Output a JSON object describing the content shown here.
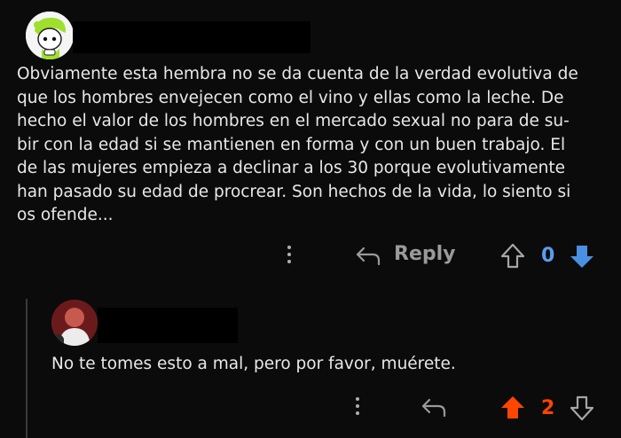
{
  "comment": {
    "text": "Obviamente esta hembra no se da cuenta de la verdad evolutiva de que los hombres envejecen como el vino y ellas como la leche. De hecho el valor de los hombres en el mercado sexual no para de su- bir con la edad si se mantienen en forma y con un buen trabajo. El de las mujeres empieza a declinar a los 30 porque evolutivamente han pasado su edad de procrear. Son hechos de la vida, lo siento si os ofende...",
    "lines": [
      "Obviamente esta hembra no se da cuenta de la verdad evolutiva de",
      "que los hombres envejecen como el vino y ellas como la leche. De",
      "hecho el valor de los hombres en el mercado sexual no para de su-",
      "bir con la edad si se mantienen en forma y con un buen trabajo. El",
      "de las mujeres empieza a declinar a los 30 porque evolutivamente",
      "han pasado su edad de procrear. Son hechos de la vida, lo siento si",
      "os ofende..."
    ],
    "reply_label": "Reply",
    "score": "0"
  },
  "reply": {
    "text": "No te tomes esto a mal, pero por favor, muérete.",
    "score": "2"
  },
  "colors": {
    "background": "#0b0b0b",
    "upvote_active": "#ff4500",
    "downvote_active": "#4a90e2",
    "score_blue": "#5b9cf0",
    "thread_line": "#3a3a3a"
  },
  "icons": {
    "upvote": "arrow-up-icon",
    "downvote": "arrow-down-icon",
    "reply": "reply-arrow-icon",
    "more": "more-vertical-icon"
  }
}
